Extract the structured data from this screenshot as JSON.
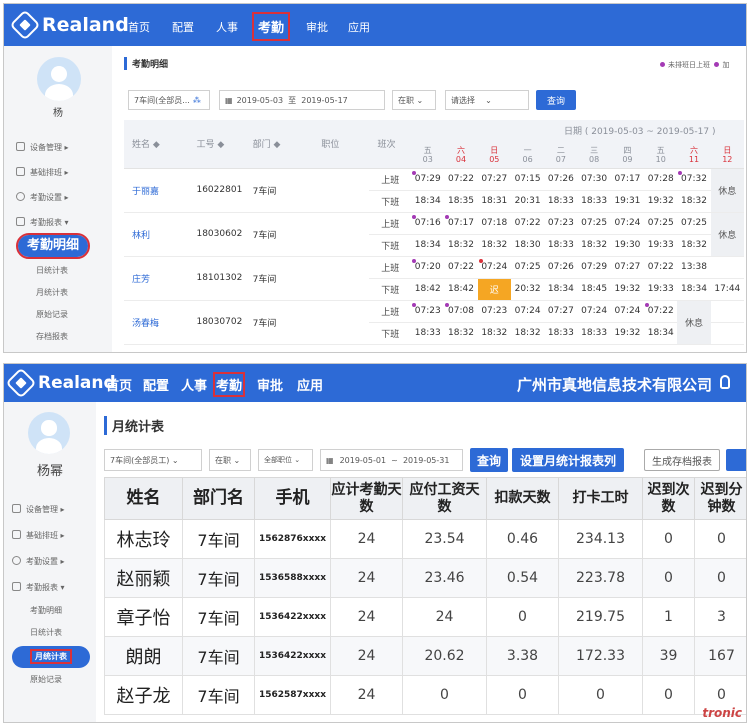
{
  "brand": "Realand",
  "colors": {
    "primary": "#2d6ad6",
    "highlight_outline": "#d9313a",
    "weekend": "#d9313a",
    "late": "#f5a623",
    "marker": "#a43ab5"
  },
  "shot1": {
    "nav": [
      "首页",
      "配置",
      "人事",
      "考勤",
      "审批",
      "应用"
    ],
    "nav_selected": "考勤",
    "user": "杨",
    "menu": [
      "设备管理",
      "基础排班",
      "考勤设置",
      "考勤报表"
    ],
    "selected": "考勤明细",
    "submenu": [
      "日统计表",
      "月统计表",
      "原始记录",
      "存档报表"
    ],
    "title": "考勤明细",
    "legend": [
      "未排班日上班",
      "加"
    ],
    "filters": {
      "dept": "7车间(全部员...",
      "date_from": "2019-05-03",
      "date_sep": "至",
      "date_to": "2019-05-17",
      "status": "在职",
      "select": "请选择",
      "query": "查询"
    },
    "date_range": "日期 ( 2019-05-03 ~ 2019-05-17 )",
    "columns": [
      "姓名 ◆",
      "工号 ◆",
      "部门 ◆",
      "职位",
      "班次"
    ],
    "days": [
      {
        "w": "五",
        "d": "03",
        "red": false
      },
      {
        "w": "六",
        "d": "04",
        "red": true
      },
      {
        "w": "日",
        "d": "05",
        "red": true
      },
      {
        "w": "一",
        "d": "06",
        "red": false
      },
      {
        "w": "二",
        "d": "07",
        "red": false
      },
      {
        "w": "三",
        "d": "08",
        "red": false
      },
      {
        "w": "四",
        "d": "09",
        "red": false
      },
      {
        "w": "五",
        "d": "10",
        "red": false
      },
      {
        "w": "六",
        "d": "11",
        "red": true
      },
      {
        "w": "日",
        "d": "12",
        "red": true
      }
    ],
    "rows": [
      {
        "name": "于丽嘉",
        "id": "16022801",
        "dept": "7车间",
        "on": [
          "07:29",
          "07:22",
          "07:27",
          "07:15",
          "07:26",
          "07:30",
          "07:17",
          "07:28",
          "07:32"
        ],
        "off": [
          "18:34",
          "18:35",
          "18:31",
          "20:31",
          "18:33",
          "18:33",
          "19:31",
          "19:32",
          "18:32"
        ],
        "last": "休息"
      },
      {
        "name": "林利",
        "id": "18030602",
        "dept": "7车间",
        "on": [
          "07:16",
          "07:17",
          "07:18",
          "07:22",
          "07:23",
          "07:25",
          "07:24",
          "07:25",
          "07:25"
        ],
        "off": [
          "18:34",
          "18:32",
          "18:32",
          "18:30",
          "18:33",
          "18:32",
          "19:30",
          "19:33",
          "18:32"
        ],
        "last": "休息"
      },
      {
        "name": "庄芳",
        "id": "18101302",
        "dept": "7车间",
        "on": [
          "07:20",
          "07:22",
          "07:24",
          "07:25",
          "07:26",
          "07:29",
          "07:27",
          "07:22",
          "13:38"
        ],
        "off": [
          "18:42",
          "18:42",
          "迟",
          "20:32",
          "18:34",
          "18:45",
          "19:32",
          "19:33",
          "18:34",
          "17:44"
        ]
      },
      {
        "name": "汤春梅",
        "id": "18030702",
        "dept": "7车间",
        "on": [
          "07:23",
          "07:08",
          "07:23",
          "07:24",
          "07:27",
          "07:24",
          "07:24",
          "07:22"
        ],
        "off": [
          "18:33",
          "18:32",
          "18:32",
          "18:32",
          "18:33",
          "18:33",
          "19:32",
          "18:34"
        ],
        "last": "休息"
      }
    ],
    "shift_on": "上班",
    "shift_off": "下班"
  },
  "shot2": {
    "nav": [
      "首页",
      "配置",
      "人事",
      "考勤",
      "审批",
      "应用"
    ],
    "nav_selected": "考勤",
    "company": "广州市真地信息技术有限公司",
    "user": "杨幂",
    "menu": [
      "设备管理",
      "基础排班",
      "考勤设置",
      "考勤报表"
    ],
    "submenu_before": [
      "考勤明细",
      "日统计表"
    ],
    "selected": "月统计表",
    "submenu_after": [
      "原始记录"
    ],
    "title": "月统计表",
    "filters": {
      "dept": "7车间(全部员工)",
      "status": "在职",
      "position": "全部职位",
      "date_from": "2019-05-01",
      "date_sep": "~",
      "date_to": "2019-05-31",
      "query": "查询",
      "set_columns": "设置月统计报表列",
      "archive": "生成存档报表"
    },
    "columns": [
      "姓名",
      "部门名",
      "手机",
      "应计考勤天数",
      "应付工资天数",
      "扣款天数",
      "打卡工时",
      "迟到次数",
      "迟到分钟数"
    ],
    "rows": [
      {
        "name": "林志玲",
        "dept": "7车间",
        "phone": "1562876xxxx",
        "att": "24",
        "pay": "23.54",
        "ded": "0.46",
        "hours": "234.13",
        "late": "0",
        "late_min": "0"
      },
      {
        "name": "赵丽颖",
        "dept": "7车间",
        "phone": "1536588xxxx",
        "att": "24",
        "pay": "23.46",
        "ded": "0.54",
        "hours": "223.78",
        "late": "0",
        "late_min": "0"
      },
      {
        "name": "章子怡",
        "dept": "7车间",
        "phone": "1536422xxxx",
        "att": "24",
        "pay": "24",
        "ded": "0",
        "hours": "219.75",
        "late": "1",
        "late_min": "3"
      },
      {
        "name": "朗朗",
        "dept": "7车间",
        "phone": "1536422xxxx",
        "att": "24",
        "pay": "20.62",
        "ded": "3.38",
        "hours": "172.33",
        "late": "39",
        "late_min": "167"
      },
      {
        "name": "赵子龙",
        "dept": "7车间",
        "phone": "1562587xxxx",
        "att": "24",
        "pay": "0",
        "ded": "0",
        "hours": "0",
        "late": "0",
        "late_min": "0"
      }
    ]
  },
  "watermark": "tronic"
}
